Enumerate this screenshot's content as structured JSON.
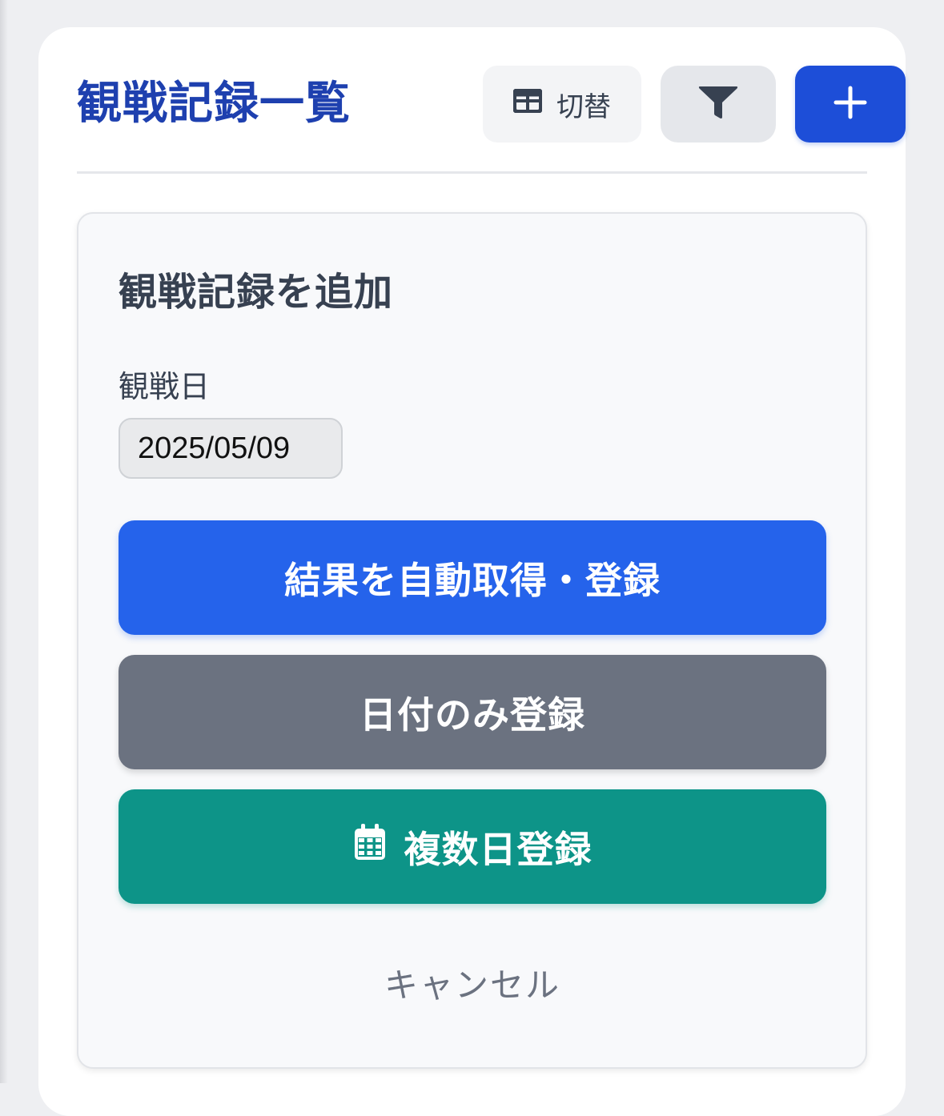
{
  "header": {
    "title": "観戦記録一覧",
    "toggle_label": "切替",
    "toggle_icon": "table-icon",
    "filter_icon": "filter-icon",
    "add_icon": "plus-icon"
  },
  "form": {
    "title": "観戦記録を追加",
    "date_label": "観戦日",
    "date_value": "2025/05/09",
    "auto_register_label": "結果を自動取得・登録",
    "date_only_label": "日付のみ登録",
    "multi_day_label": "複数日登録",
    "multi_day_icon": "calendar-icon",
    "cancel_label": "キャンセル"
  },
  "colors": {
    "title": "#1e40af",
    "add_button": "#1d4ed8",
    "auto_button": "#2563eb",
    "date_only_button": "#6b7280",
    "multi_day_button": "#0d9488"
  }
}
